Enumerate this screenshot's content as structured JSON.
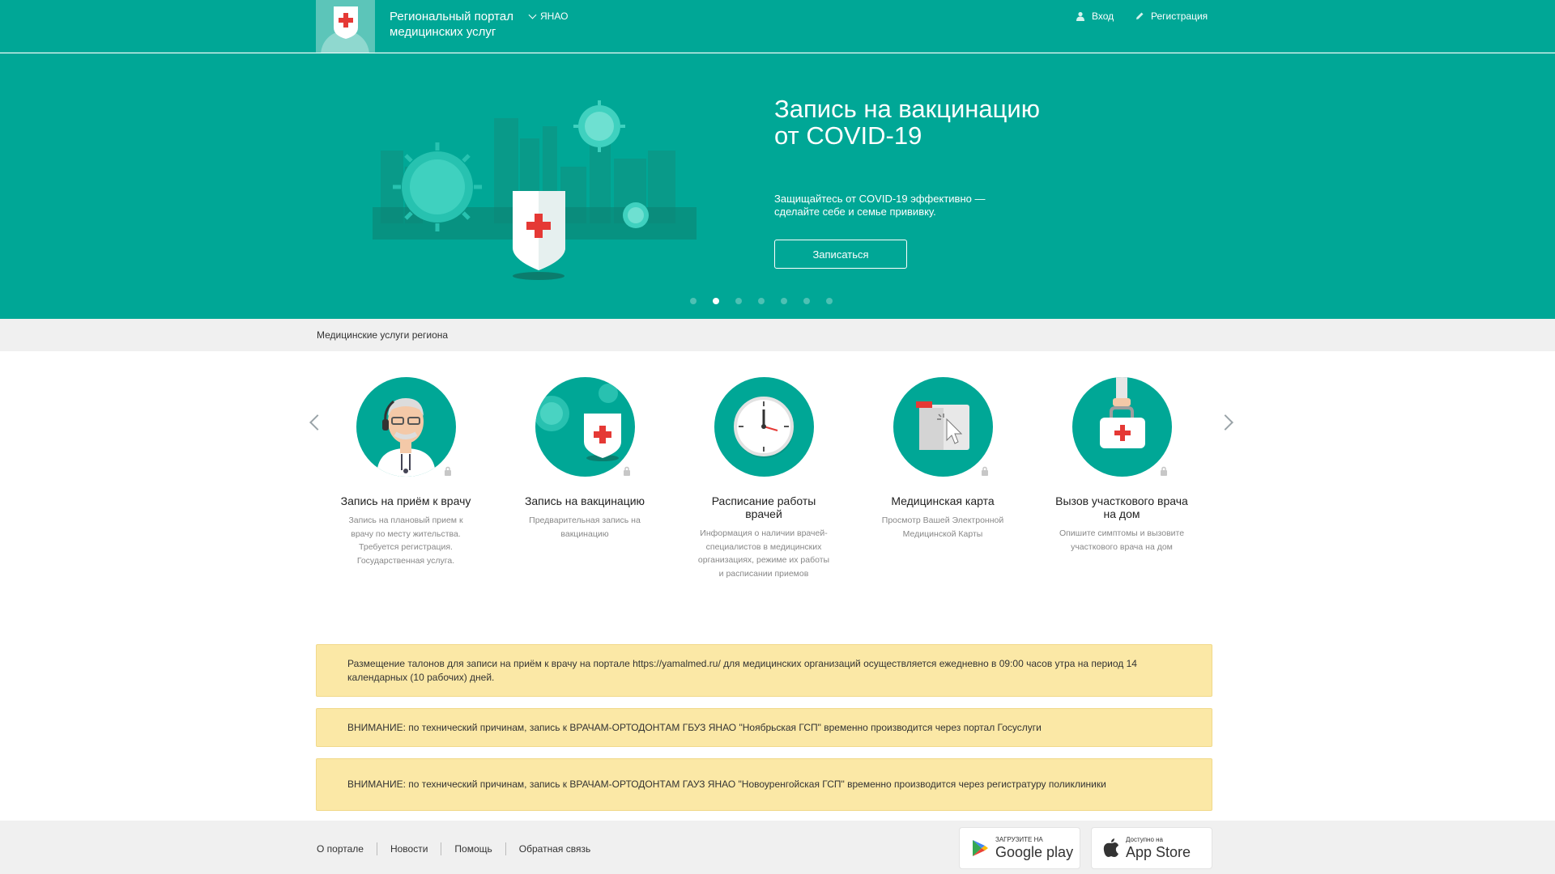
{
  "header": {
    "portal_title": "Региональный портал медицинских услуг",
    "region": "ЯНАО",
    "login": "Вход",
    "register": "Регистрация"
  },
  "hero": {
    "title": "Запись на вакцинацию от COVID-19",
    "subtitle": "Защищайтесь от COVID-19 эффективно — сделайте себе и семье прививку.",
    "button": "Записаться",
    "slides_total": 7,
    "active_slide": 2
  },
  "section": {
    "title": "Медицинские услуги региона"
  },
  "services": [
    {
      "title": "Запись на приём к врачу",
      "desc": "Запись на плановый прием к врачу по месту жительства. Требуется регистрация. Государственная услуга.",
      "icon": "doctor-icon"
    },
    {
      "title": "Запись на вакцинацию",
      "desc": "Предварительная запись на вакцинацию",
      "icon": "vaccine-shield-icon"
    },
    {
      "title": "Расписание работы врачей",
      "desc": "Информация о наличии врачей-специалистов в медицинских организациях, режиме их работы и расписании приемов",
      "icon": "clock-icon"
    },
    {
      "title": "Медицинская карта",
      "desc": "Просмотр Вашей Электронной Медицинской Карты",
      "icon": "medical-card-icon"
    },
    {
      "title": "Вызов участкового врача на дом",
      "desc": "Опишите симптомы и вызовите участкового врача на дом",
      "icon": "first-aid-kit-icon"
    }
  ],
  "notices": [
    "Размещение талонов для записи на приём к врачу на портале https://yamalmed.ru/ для медицинских организаций осуществляется ежедневно в 09:00 часов утра на период 14 календарных (10 рабочих) дней.",
    "ВНИМАНИЕ: по технический причинам, запись к ВРАЧАМ-ОРТОДОНТАМ ГБУЗ ЯНАО \"Ноябрьская ГСП\" временно производится через портал Госуслуги",
    "ВНИМАНИЕ: по технический причинам, запись к ВРАЧАМ-ОРТОДОНТАМ ГАУЗ ЯНАО \"Новоуренгойская ГСП\" временно производится через регистратуру поликлиники"
  ],
  "footer": {
    "links": [
      "О портале",
      "Новости",
      "Помощь",
      "Обратная связь"
    ],
    "google_small": "ЗАГРУЗИТЕ НА",
    "google_big": "Google play",
    "apple_small": "Доступно на",
    "apple_big": "App Store"
  },
  "colors": {
    "brand": "#00a796",
    "notice_bg": "#fbe8a6",
    "cross_red": "#e53935"
  }
}
